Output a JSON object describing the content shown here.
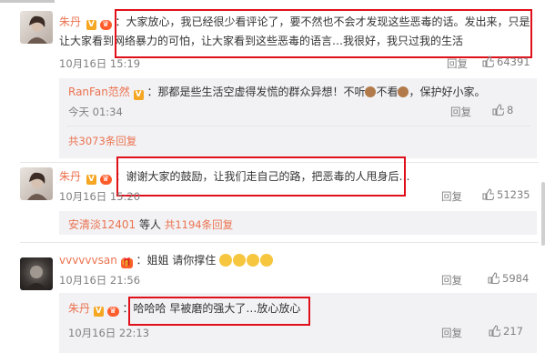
{
  "comments": [
    {
      "user": "朱丹",
      "text_line1": "：大家放心，我已经很少看评论了，要不然也不会才发现这些恶毒的话。发出来，只是",
      "text_line2": "让大家看到网络暴力的可怕，让大家看到这些恶毒的语言…我很好，我只过我的生活",
      "time": "10月16日 15:19",
      "reply": "回复",
      "likes": "64391",
      "sub": {
        "user": "RanFan范然",
        "text": "：那都是些生活空虚得发慌的群众异想！不听",
        "text2": "不看",
        "text3": "，保护好小家。",
        "time": "今天 01:34",
        "reply": "回复",
        "likes": "8"
      },
      "more": "共3073条回复"
    },
    {
      "user": "朱丹",
      "text": "：谢谢大家的鼓励，让我们走自己的路，把恶毒的人甩身后…",
      "time": "10月16日 15:20",
      "reply": "回复",
      "likes": "51235",
      "more_user": "安清淡12401",
      "more_mid": " 等人 ",
      "more": "共1194条回复"
    },
    {
      "user": "vvvvvvsan",
      "text": "：姐姐 请你撑住",
      "time": "10月16日 21:56",
      "reply": "回复",
      "likes": "5984",
      "sub": {
        "user": "朱丹",
        "text": "：哈哈哈 早被磨的强大了…放心放心",
        "time": "10月16日 22:13",
        "reply": "回复",
        "likes": "217"
      }
    }
  ],
  "colors": {
    "accent": "#eb7350",
    "highlight": "#e0101a",
    "muted": "#808080"
  }
}
